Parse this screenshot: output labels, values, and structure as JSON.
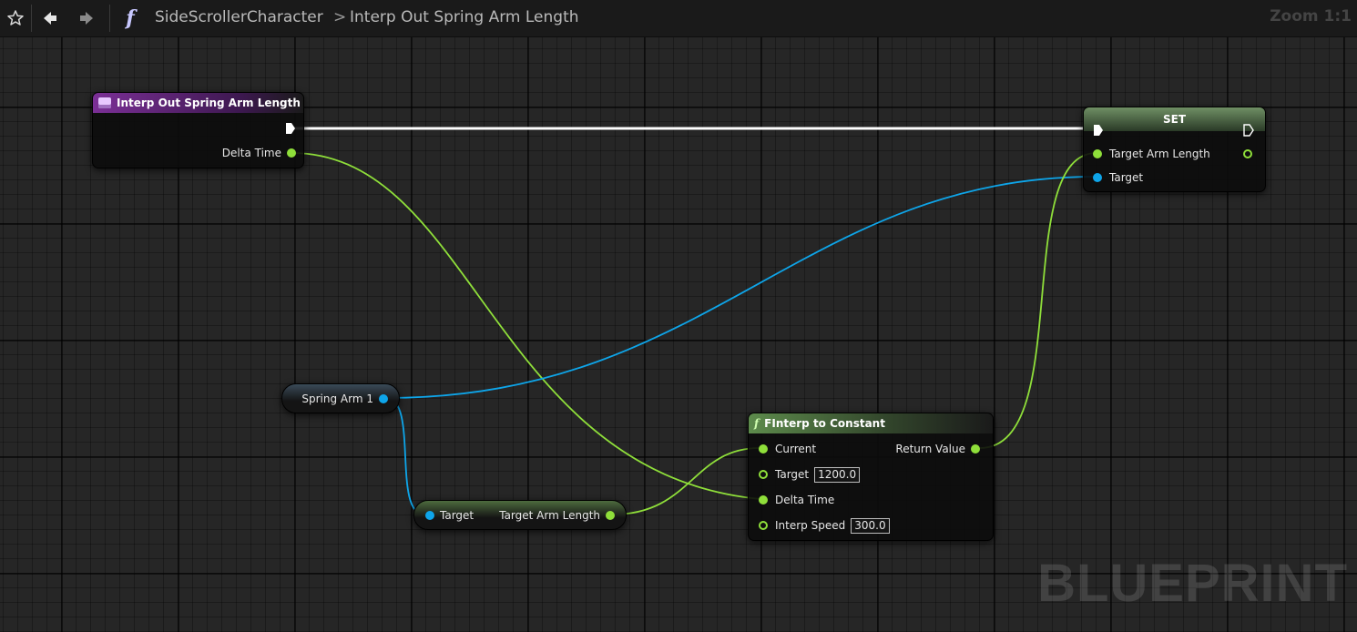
{
  "toolbar": {
    "breadcrumb": [
      "SideScrollerCharacter",
      "Interp Out Spring Arm Length"
    ],
    "separator": ">",
    "zoom": "Zoom 1:1",
    "icons": [
      "star-icon",
      "back-arrow-icon",
      "forward-arrow-icon",
      "function-icon"
    ]
  },
  "watermark": "BLUEPRINT",
  "colors": {
    "float_pin": "#8fdf3a",
    "object_pin": "#0ea5e9",
    "exec_pin": "#ffffff",
    "event_header": "#6b2a84",
    "function_header": "#3d6b33",
    "set_header": "#5a7a50"
  },
  "nodes": {
    "event": {
      "title": "Interp Out Spring Arm Length",
      "outputs": [
        "Delta Time"
      ]
    },
    "set": {
      "title": "SET",
      "inputs": [
        "Target Arm Length",
        "Target"
      ]
    },
    "spring_arm": {
      "title": "Spring Arm 1"
    },
    "get_arm": {
      "input": "Target",
      "output": "Target Arm Length"
    },
    "finterp": {
      "title": "FInterp to Constant",
      "inputs": [
        {
          "label": "Current",
          "value": ""
        },
        {
          "label": "Target",
          "value": "1200.0"
        },
        {
          "label": "Delta Time",
          "value": ""
        },
        {
          "label": "Interp Speed",
          "value": "300.0"
        }
      ],
      "output": "Return Value"
    }
  }
}
